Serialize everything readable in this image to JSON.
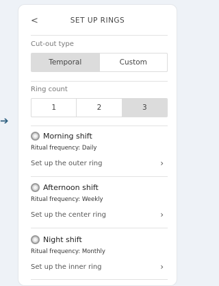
{
  "header": {
    "back_icon": "chevron-left-icon",
    "back_glyph": "<",
    "title": "SET UP RINGS"
  },
  "cutout": {
    "label": "Cut-out type",
    "options": [
      "Temporal",
      "Custom"
    ],
    "selected": "Temporal"
  },
  "ring_count": {
    "label": "Ring count",
    "options": [
      "1",
      "2",
      "3"
    ],
    "selected": "3"
  },
  "shifts": [
    {
      "name": "Morning shift",
      "frequency": "Ritual frequency: Daily",
      "link": "Set up the outer ring"
    },
    {
      "name": "Afternoon shift",
      "frequency": "Ritual frequency: Weekly",
      "link": "Set up the center ring"
    },
    {
      "name": "Night shift",
      "frequency": "Ritual frequency: Monthly",
      "link": "Set up the inner ring"
    }
  ],
  "chevron_glyph": "›"
}
